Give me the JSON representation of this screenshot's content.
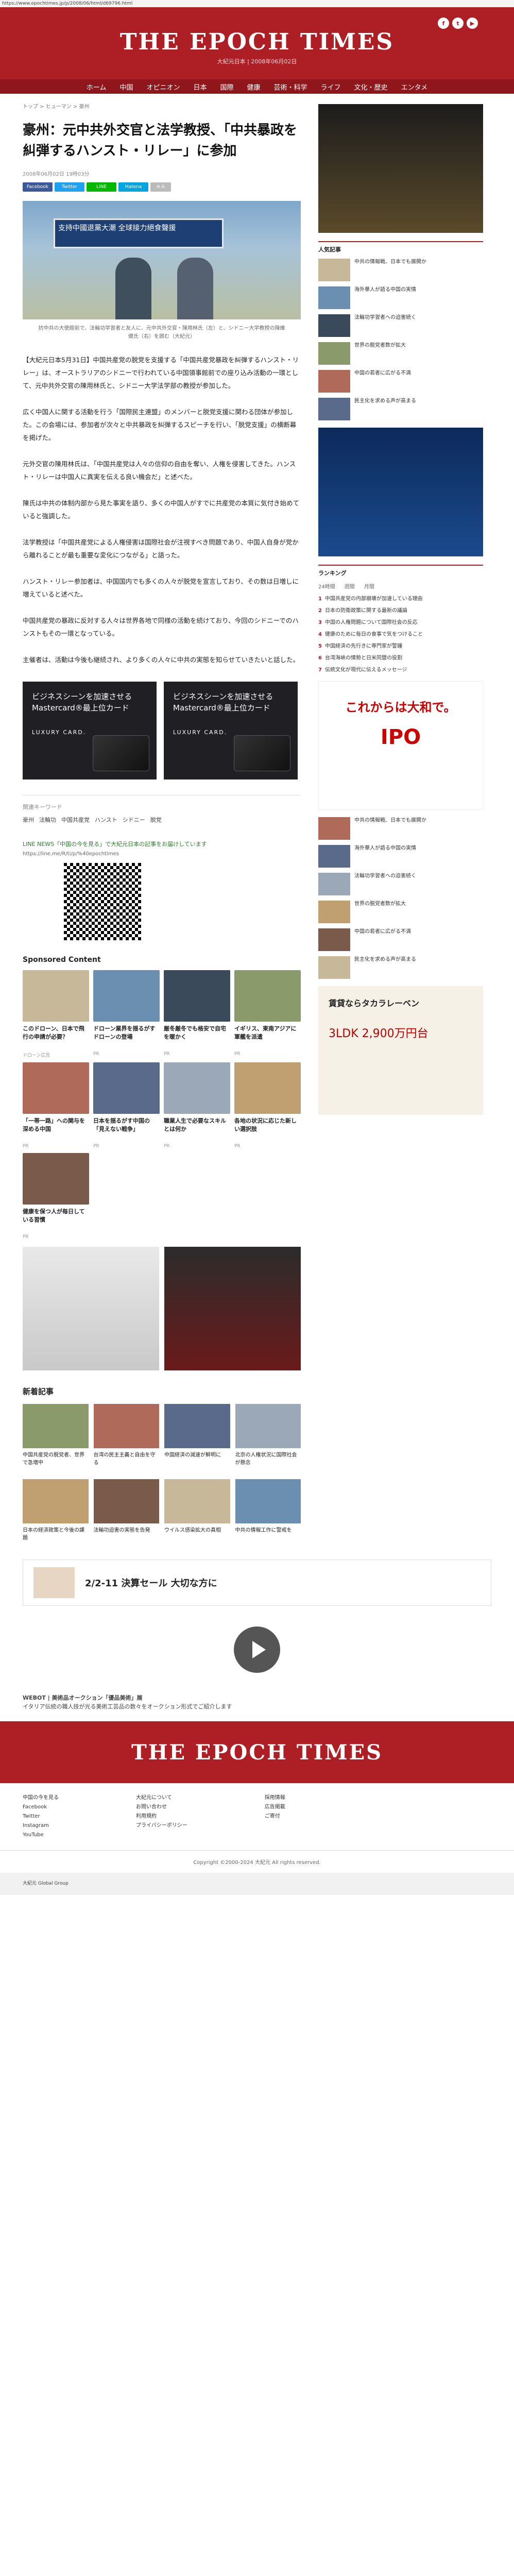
{
  "url": "https://www.epochtimes.jp/p/2008/06/html/d69796.html",
  "site": {
    "name": "THE EPOCH TIMES",
    "sub": "大紀元日本 | 2008年06月02日"
  },
  "nav": [
    "ホーム",
    "中国",
    "オピニオン",
    "日本",
    "国際",
    "健康",
    "芸術・科学",
    "ライフ",
    "文化・歴史",
    "エンタメ"
  ],
  "breadcrumb": "トップ > ヒューマン > 豪州",
  "article": {
    "title": "豪州：元中共外交官と法学教授、「中共暴政を糾弾するハンスト・リレー」に参加",
    "meta": "2008年06月02日 19時03分",
    "share": [
      "Facebook",
      "Twitter",
      "LINE",
      "Hatena"
    ],
    "hero_banner": "支持中國退黨大潮 全球接力絕食聲援",
    "caption": "抗中共の大使館前で、法輪功学習者と友人に、元中共外交官・陳用林氏（左）と、シドニー大学教授の陳維健氏（右）を囲む（大紀元）",
    "paragraphs": [
      "【大紀元日本5月31日】中国共産党の脱党を支援する「中国共産党暴政を糾弾するハンスト・リレー」は、オーストラリアのシドニーで行われている中国領事館前での座り込み活動の一環として、元中共外交官の陳用林氏と、シドニー大学法学部の教授が参加した。",
      "広く中国人に関する活動を行う「国際民主連盟」のメンバーと脱党支援に関わる団体が参加した。この会場には、参加者が次々と中共暴政を糾弾するスピーチを行い、「脱党支援」の横断幕を掲げた。",
      "元外交官の陳用林氏は、「中国共産党は人々の信仰の自由を奪い、人権を侵害してきた。ハンスト・リレーは中国人に真実を伝える良い機会だ」と述べた。",
      "陳氏は中共の体制内部から見た事実を語り、多くの中国人がすでに共産党の本質に気付き始めていると強調した。",
      "法学教授は「中国共産党による人権侵害は国際社会が注視すべき問題であり、中国人自身が党から離れることが最も重要な変化につながる」と語った。",
      "ハンスト・リレー参加者は、中国国内でも多くの人々が脱党を宣言しており、その数は日増しに増えていると述べた。",
      "中国共産党の暴政に反対する人々は世界各地で同様の活動を続けており、今回のシドニーでのハンストもその一環となっている。",
      "主催者は、活動は今後も継続され、より多くの人々に中共の実態を知らせていきたいと話した。"
    ]
  },
  "ads": {
    "card_headline": "ビジネスシーンを加速させる Mastercard®最上位カード",
    "card_brand": "LUXURY CARD.",
    "sponsored_title": "Sponsored Content"
  },
  "tags_label": "関連キーワード",
  "tags": [
    "豪州",
    "法輪功",
    "中国共産党",
    "ハンスト",
    "シドニー",
    "脱党"
  ],
  "line_text": "LINE NEWS「中国の今を見る」で大紀元日本の記事をお届けしています",
  "line_url": "https://line.me/R/ti/p/%40epochtimes",
  "sponsored": [
    {
      "t": "このドローン、日本で飛行の申請が必要？",
      "s": "ドローン広告"
    },
    {
      "t": "ドローン業界を揺るがすドローンの登場",
      "s": "PR"
    },
    {
      "t": "厳冬厳冬でも格安で自宅を暖かく",
      "s": "PR"
    },
    {
      "t": "イギリス、東南アジアに軍艦を派遣",
      "s": "PR"
    },
    {
      "t": "「一帯一路」への関与を深める中国",
      "s": "PR"
    },
    {
      "t": "日本を揺るがす中国の「見えない戦争」",
      "s": "PR"
    },
    {
      "t": "職業人生で必要なスキルとは何か",
      "s": "PR"
    },
    {
      "t": "各地の状況に応じた新しい選択肢",
      "s": "PR"
    },
    {
      "t": "健康を保つ人が毎日している習慣",
      "s": "PR"
    }
  ],
  "news_title": "新着記事",
  "news": [
    "中国共産党の脱党者、世界で急増中",
    "台湾の民主主義と自由を守る",
    "中国経済の減速が鮮明に",
    "北京の人権状況に国際社会が懸念",
    "日本の経済政策と今後の課題",
    "法輪功迫害の実態を告発",
    "ウイルス感染拡大の真相",
    "中共の情報工作に警戒を"
  ],
  "sidebar": {
    "popular_title": "人気記事",
    "ranking_title": "ランキング",
    "ranking_tabs": [
      "24時間",
      "週間",
      "月間"
    ],
    "ranking": [
      "中国共産党の内部崩壊が加速している理由",
      "日本の防衛政策に関する最新の議論",
      "中国の人権問題について国際社会の反応",
      "健康のために毎日の食事で気をつけること",
      "中国経済の先行きに専門家が警鐘",
      "台湾海峡の情勢と日米同盟の役割",
      "伝統文化が現代に伝えるメッセージ"
    ],
    "side_items": [
      "中共の情報戦、日本でも展開か",
      "海外華人が語る中国の実情",
      "法輪功学習者への迫害続く",
      "世界の脱党者数が拡大",
      "中国の若者に広がる不満",
      "民主化を求める声が高まる"
    ],
    "ad_text": "これからは大和で。",
    "ad_sub": "IPO",
    "rental": "賃貸ならタカラレーベン",
    "rental_price": "3LDK 2,900万円台"
  },
  "bottom": {
    "ad_text": "2/2-11 決算セール 大切な方に",
    "webot": "WEBOT | 美術品オークション「優品美術」展",
    "webot_desc": "イタリア伝統の職人技が光る美術工芸品の数々をオークション形式でご紹介します"
  },
  "footer": {
    "logo": "THE EPOCH TIMES",
    "col1": [
      "中国の今を見る",
      "Facebook",
      "Twitter",
      "Instagram",
      "YouTube"
    ],
    "col2": [
      "大紀元について",
      "お問い合わせ",
      "利用規約",
      "プライバシーポリシー"
    ],
    "col3": [
      "採用情報",
      "広告掲載",
      "ご寄付"
    ],
    "copyright": "Copyright ©2000-2024 大紀元 All rights reserved.",
    "group": "大紀元 Global Group"
  }
}
